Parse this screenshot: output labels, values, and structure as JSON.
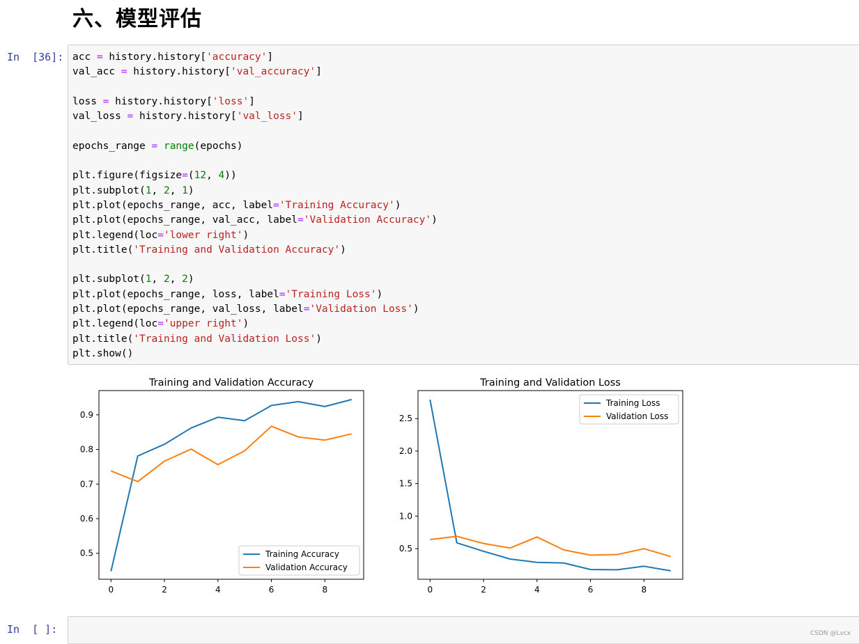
{
  "heading": "六、模型评估",
  "cell1": {
    "prompt": "In  [36]:",
    "code_lines": [
      [
        [
          "acc ",
          ""
        ],
        [
          "=",
          "op"
        ],
        [
          " history.history[",
          ""
        ],
        [
          "'accuracy'",
          "str"
        ],
        [
          "]",
          ""
        ]
      ],
      [
        [
          "val_acc ",
          ""
        ],
        [
          "=",
          "op"
        ],
        [
          " history.history[",
          ""
        ],
        [
          "'val_accuracy'",
          "str"
        ],
        [
          "]",
          ""
        ]
      ],
      [],
      [
        [
          "loss ",
          ""
        ],
        [
          "=",
          "op"
        ],
        [
          " history.history[",
          ""
        ],
        [
          "'loss'",
          "str"
        ],
        [
          "]",
          ""
        ]
      ],
      [
        [
          "val_loss ",
          ""
        ],
        [
          "=",
          "op"
        ],
        [
          " history.history[",
          ""
        ],
        [
          "'val_loss'",
          "str"
        ],
        [
          "]",
          ""
        ]
      ],
      [],
      [
        [
          "epochs_range ",
          ""
        ],
        [
          "=",
          "op"
        ],
        [
          " ",
          ""
        ],
        [
          "range",
          "bi"
        ],
        [
          "(epochs)",
          ""
        ]
      ],
      [],
      [
        [
          "plt.figure(figsize",
          ""
        ],
        [
          "=",
          "op"
        ],
        [
          "(",
          ""
        ],
        [
          "12",
          "num"
        ],
        [
          ", ",
          ""
        ],
        [
          "4",
          "num"
        ],
        [
          "))",
          ""
        ]
      ],
      [
        [
          "plt.subplot(",
          ""
        ],
        [
          "1",
          "num"
        ],
        [
          ", ",
          ""
        ],
        [
          "2",
          "num"
        ],
        [
          ", ",
          ""
        ],
        [
          "1",
          "num"
        ],
        [
          ")",
          ""
        ]
      ],
      [
        [
          "plt.plot(epochs_range, acc, label",
          ""
        ],
        [
          "=",
          "op"
        ],
        [
          "'Training Accuracy'",
          "str"
        ],
        [
          ")",
          ""
        ]
      ],
      [
        [
          "plt.plot(epochs_range, val_acc, label",
          ""
        ],
        [
          "=",
          "op"
        ],
        [
          "'Validation Accuracy'",
          "str"
        ],
        [
          ")",
          ""
        ]
      ],
      [
        [
          "plt.legend(loc",
          ""
        ],
        [
          "=",
          "op"
        ],
        [
          "'lower right'",
          "str"
        ],
        [
          ")",
          ""
        ]
      ],
      [
        [
          "plt.title(",
          ""
        ],
        [
          "'Training and Validation Accuracy'",
          "str"
        ],
        [
          ")",
          ""
        ]
      ],
      [],
      [
        [
          "plt.subplot(",
          ""
        ],
        [
          "1",
          "num"
        ],
        [
          ", ",
          ""
        ],
        [
          "2",
          "num"
        ],
        [
          ", ",
          ""
        ],
        [
          "2",
          "num"
        ],
        [
          ")",
          ""
        ]
      ],
      [
        [
          "plt.plot(epochs_range, loss, label",
          ""
        ],
        [
          "=",
          "op"
        ],
        [
          "'Training Loss'",
          "str"
        ],
        [
          ")",
          ""
        ]
      ],
      [
        [
          "plt.plot(epochs_range, val_loss, label",
          ""
        ],
        [
          "=",
          "op"
        ],
        [
          "'Validation Loss'",
          "str"
        ],
        [
          ")",
          ""
        ]
      ],
      [
        [
          "plt.legend(loc",
          ""
        ],
        [
          "=",
          "op"
        ],
        [
          "'upper right'",
          "str"
        ],
        [
          ")",
          ""
        ]
      ],
      [
        [
          "plt.title(",
          ""
        ],
        [
          "'Training and Validation Loss'",
          "str"
        ],
        [
          ")",
          ""
        ]
      ],
      [
        [
          "plt.show()",
          ""
        ]
      ]
    ]
  },
  "cell2": {
    "prompt": "In  [ ]:"
  },
  "watermark": "CSDN @Lvcx",
  "chart_data": [
    {
      "type": "line",
      "title": "Training and Validation Accuracy",
      "x": [
        0,
        1,
        2,
        3,
        4,
        5,
        6,
        7,
        8,
        9
      ],
      "xticks": [
        0,
        2,
        4,
        6,
        8
      ],
      "yticks": [
        0.5,
        0.6,
        0.7,
        0.8,
        0.9
      ],
      "xlim": [
        -0.45,
        9.45
      ],
      "ylim": [
        0.425,
        0.97
      ],
      "legend_loc": "lower right",
      "series": [
        {
          "name": "Training Accuracy",
          "color": "#1f77b4",
          "values": [
            0.448,
            0.781,
            0.815,
            0.862,
            0.893,
            0.883,
            0.927,
            0.938,
            0.924,
            0.944
          ]
        },
        {
          "name": "Validation Accuracy",
          "color": "#ff7f0e",
          "values": [
            0.738,
            0.707,
            0.766,
            0.801,
            0.756,
            0.796,
            0.867,
            0.836,
            0.827,
            0.845
          ]
        }
      ]
    },
    {
      "type": "line",
      "title": "Training and Validation Loss",
      "x": [
        0,
        1,
        2,
        3,
        4,
        5,
        6,
        7,
        8,
        9
      ],
      "xticks": [
        0,
        2,
        4,
        6,
        8
      ],
      "yticks": [
        0.5,
        1.0,
        1.5,
        2.0,
        2.5
      ],
      "ytick_labels": [
        "0.5",
        "1.0",
        "1.5",
        "2.0",
        "2.5"
      ],
      "xlim": [
        -0.45,
        9.45
      ],
      "ylim": [
        0.03,
        2.93
      ],
      "legend_loc": "upper right",
      "series": [
        {
          "name": "Training Loss",
          "color": "#1f77b4",
          "values": [
            2.79,
            0.59,
            0.46,
            0.34,
            0.29,
            0.28,
            0.18,
            0.175,
            0.23,
            0.16
          ]
        },
        {
          "name": "Validation Loss",
          "color": "#ff7f0e",
          "values": [
            0.64,
            0.69,
            0.58,
            0.51,
            0.68,
            0.48,
            0.4,
            0.41,
            0.5,
            0.38
          ]
        }
      ]
    }
  ]
}
